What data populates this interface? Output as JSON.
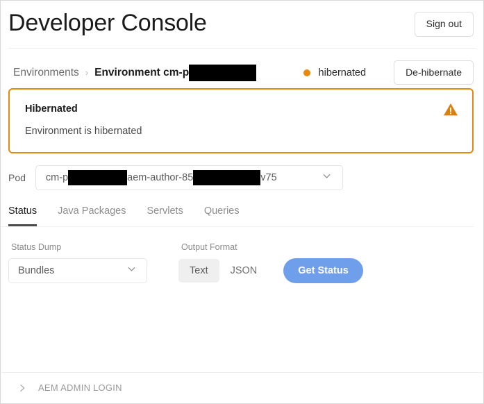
{
  "header": {
    "title": "Developer Console",
    "sign_out_label": "Sign out"
  },
  "breadcrumb": {
    "root_label": "Environments",
    "separator": "›",
    "current_label": "Environment cm-p",
    "current_redacted": true
  },
  "environment_status": {
    "state_label": "hibernated",
    "dot_color": "#e8890c",
    "action_label": "De-hibernate"
  },
  "alert": {
    "title": "Hibernated",
    "message": "Environment is hibernated",
    "icon": "warning-triangle-icon",
    "border_color": "#e8890c",
    "icon_color": "#e0820f"
  },
  "pod": {
    "label": "Pod",
    "value_part_1": "cm-p",
    "value_part_2": "aem-author-85",
    "value_part_3": "v75",
    "chevron": "chevron-down-icon"
  },
  "tabs": [
    {
      "label": "Status",
      "active": true
    },
    {
      "label": "Java Packages",
      "active": false
    },
    {
      "label": "Servlets",
      "active": false
    },
    {
      "label": "Queries",
      "active": false
    }
  ],
  "controls": {
    "status_dump": {
      "label": "Status Dump",
      "value": "Bundles",
      "chevron": "chevron-down-icon"
    },
    "output_format": {
      "label": "Output Format",
      "options": [
        {
          "label": "Text",
          "selected": true
        },
        {
          "label": "JSON",
          "selected": false
        }
      ]
    },
    "submit_label": "Get Status",
    "submit_color": "#6f9eeb"
  },
  "footer": {
    "accordion_label": "AEM ADMIN LOGIN",
    "chevron": "chevron-right-icon",
    "expanded": false
  }
}
